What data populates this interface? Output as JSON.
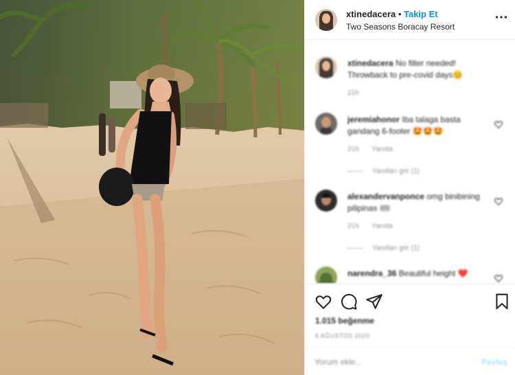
{
  "post": {
    "username": "xtinedacera",
    "dot": "•",
    "follow_label": "Takip Et",
    "location": "Two Seasons Boracay Resort",
    "more_icon": "more-options-icon"
  },
  "comments": [
    {
      "username": "xtinedacera",
      "text": "No filter needed! Throwback to pre-covid days😊",
      "time": "21h",
      "reply": "",
      "replies_label": ""
    },
    {
      "username": "jeremiahonor",
      "text": "Iba talaga basta gandang 6-footer 🤩🤩🤩",
      "time": "21h",
      "reply": "Yanıtla",
      "replies_label": "Yanıtları gör (1)"
    },
    {
      "username": "alexandervanponce",
      "text": "omg binibining pilipinas 🎟",
      "time": "21h",
      "reply": "Yanıtla",
      "replies_label": "Yanıtları gör (1)"
    },
    {
      "username": "narendra_36",
      "text": "Beautiful height ❤️",
      "time": "",
      "reply": "",
      "replies_label": ""
    }
  ],
  "actions": {
    "icons": [
      "heart-icon",
      "comment-icon",
      "share-icon",
      "bookmark-icon"
    ],
    "likes": "1.015 beğenme",
    "date": "6 AĞUSTOS 2020"
  },
  "add_comment": {
    "placeholder": "Yorum ekle...",
    "post_label": "Paylaş"
  },
  "colors": {
    "accent": "#0095f6",
    "text": "#262626",
    "muted": "#8e8e8e",
    "post_disabled": "#b2dffc"
  }
}
